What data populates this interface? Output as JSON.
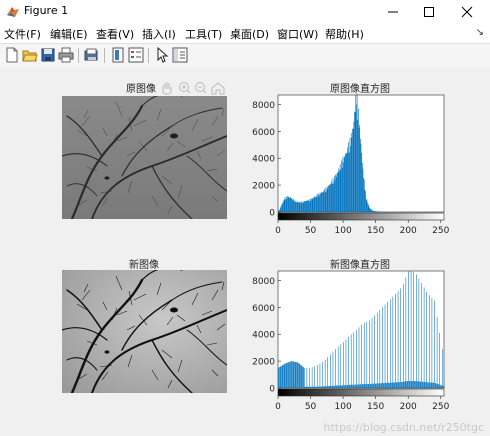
{
  "window": {
    "title": "Figure 1",
    "icons": {
      "app": "matlab-icon",
      "minimize": "minimize-icon",
      "maximize": "maximize-icon",
      "close": "close-icon"
    }
  },
  "menubar": {
    "items": [
      "文件(F)",
      "编辑(E)",
      "查看(V)",
      "插入(I)",
      "工具(T)",
      "桌面(D)",
      "窗口(W)",
      "帮助(H)"
    ],
    "dock_arrow": "↘"
  },
  "toolbar": {
    "buttons": [
      "new-figure-icon",
      "open-file-icon",
      "save-icon",
      "print-icon",
      "print-preview-icon",
      "colorbar-icon",
      "legend-icon",
      "edit-plot-icon",
      "property-inspector-icon"
    ]
  },
  "axes_toolbar": {
    "buttons": [
      "pan-icon",
      "zoom-in-icon",
      "zoom-out-icon",
      "home-icon"
    ]
  },
  "panels": {
    "orig_image_title": "原图像",
    "orig_hist_title": "原图像直方图",
    "new_image_title": "新图像",
    "new_hist_title": "新图像直方图"
  },
  "watermark": "https://blog.csdn.net/r250tgc",
  "chart_data": [
    {
      "type": "bar",
      "title": "原图像直方图",
      "xlim": [
        0,
        255
      ],
      "ylim": [
        0,
        8700
      ],
      "xticks": [
        0,
        50,
        100,
        150,
        200,
        250
      ],
      "yticks": [
        0,
        2000,
        4000,
        6000,
        8000
      ],
      "color": "#0072bd",
      "colorbar": "gray",
      "series": [
        {
          "x": [
            0,
            5,
            10,
            15,
            20,
            25,
            30,
            35,
            40,
            50,
            60,
            70,
            80,
            90,
            100,
            105,
            110,
            115,
            120,
            125,
            130,
            135,
            140,
            145,
            150,
            160,
            170,
            200,
            255
          ],
          "values": [
            0,
            500,
            1000,
            1100,
            1000,
            800,
            700,
            700,
            750,
            900,
            1200,
            1500,
            2000,
            2700,
            3800,
            4300,
            5000,
            6000,
            8500,
            6000,
            3000,
            1000,
            300,
            100,
            50,
            20,
            0,
            0,
            0
          ]
        }
      ]
    },
    {
      "type": "bar",
      "title": "新图像直方图",
      "xlim": [
        0,
        255
      ],
      "ylim": [
        0,
        8700
      ],
      "xticks": [
        0,
        50,
        100,
        150,
        200,
        250
      ],
      "yticks": [
        0,
        2000,
        4000,
        6000,
        8000
      ],
      "color": "#0072bd",
      "colorbar": "gray",
      "series": [
        {
          "x": [
            0,
            10,
            20,
            30,
            40,
            50,
            60,
            70,
            80,
            90,
            100,
            110,
            120,
            130,
            140,
            150,
            160,
            170,
            180,
            190,
            200,
            210,
            220,
            230,
            240,
            250,
            255
          ],
          "values": [
            1500,
            1800,
            2000,
            1900,
            1500,
            1500,
            1700,
            2000,
            2500,
            3000,
            3400,
            3900,
            4300,
            4800,
            5000,
            5500,
            6000,
            6500,
            7000,
            7500,
            8700,
            8600,
            7800,
            7000,
            6500,
            3500,
            2000
          ]
        }
      ]
    }
  ]
}
